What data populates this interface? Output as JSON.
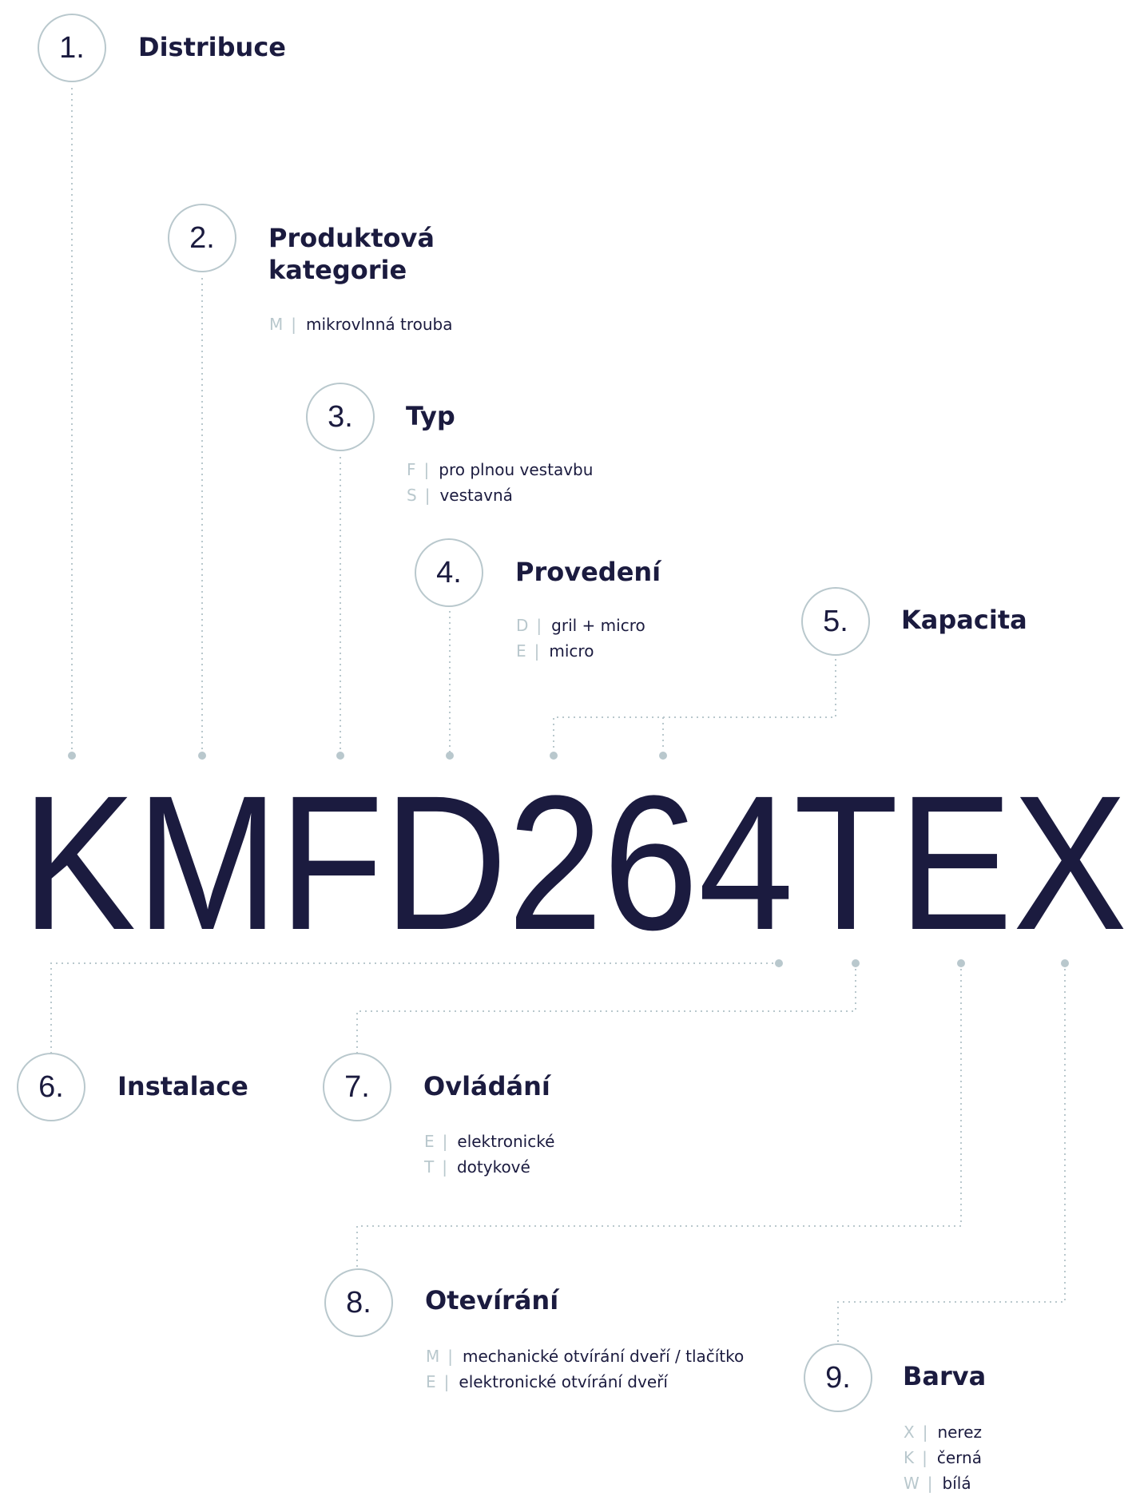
{
  "model_code": "KMFD264TEX",
  "sections": [
    {
      "number": "1.",
      "title": "Distribuce",
      "options": []
    },
    {
      "number": "2.",
      "title": "Produktová kategorie",
      "options": [
        {
          "code": "M",
          "label": "mikrovlnná trouba"
        }
      ]
    },
    {
      "number": "3.",
      "title": "Typ",
      "options": [
        {
          "code": "F",
          "label": "pro plnou vestavbu"
        },
        {
          "code": "S",
          "label": "vestavná"
        }
      ]
    },
    {
      "number": "4.",
      "title": "Provedení",
      "options": [
        {
          "code": "D",
          "label": "gril + micro"
        },
        {
          "code": "E",
          "label": "micro"
        }
      ]
    },
    {
      "number": "5.",
      "title": "Kapacita",
      "options": []
    },
    {
      "number": "6.",
      "title": "Instalace",
      "options": []
    },
    {
      "number": "7.",
      "title": "Ovládání",
      "options": [
        {
          "code": "E",
          "label": "elektronické"
        },
        {
          "code": "T",
          "label": "dotykové"
        }
      ]
    },
    {
      "number": "8.",
      "title": "Otevírání",
      "options": [
        {
          "code": "M",
          "label": "mechanické otvírání dveří / tlačítko"
        },
        {
          "code": "E",
          "label": "elektronické otvírání dveří"
        }
      ]
    },
    {
      "number": "9.",
      "title": "Barva",
      "options": [
        {
          "code": "X",
          "label": "nerez"
        },
        {
          "code": "K",
          "label": "černá"
        },
        {
          "code": "W",
          "label": "bílá"
        }
      ]
    }
  ],
  "colors": {
    "text": "#1b1b3f",
    "accent": "#b9c8cd",
    "background": "#ffffff"
  }
}
